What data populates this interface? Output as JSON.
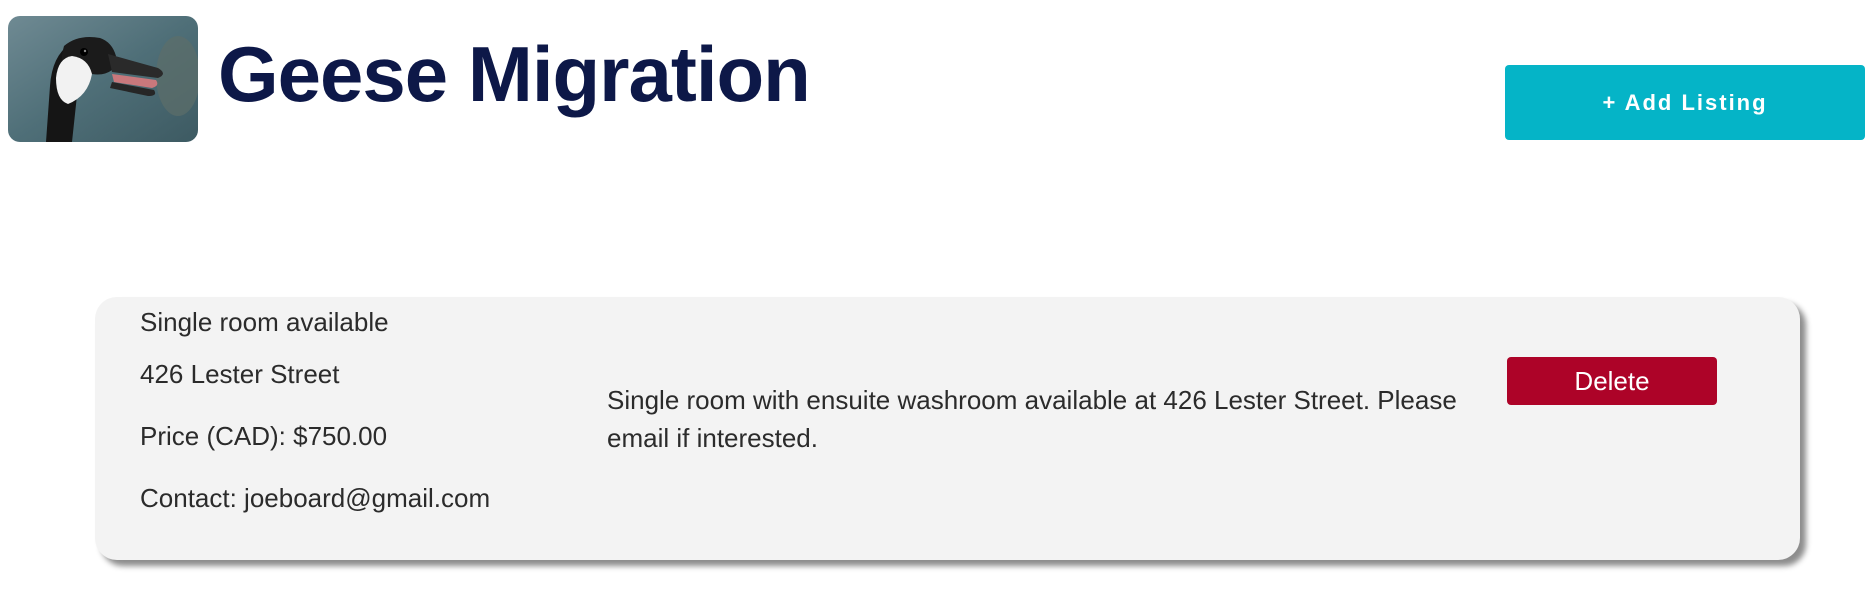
{
  "header": {
    "title": "Geese Migration",
    "add_listing_label": "+ Add Listing"
  },
  "logo": {
    "icon": "goose-logo-image"
  },
  "listing": {
    "title": "Single room available",
    "address": "426 Lester Street",
    "price": "Price (CAD): $750.00",
    "contact": "Contact: joeboard@gmail.com",
    "description": "Single room with ensuite washroom available at 426 Lester Street. Please email if interested.",
    "delete_label": "Delete"
  },
  "colors": {
    "title": "#0d1848",
    "add_button": "#05b4c7",
    "delete_button": "#ad0328",
    "card_background": "#f3f3f3"
  }
}
